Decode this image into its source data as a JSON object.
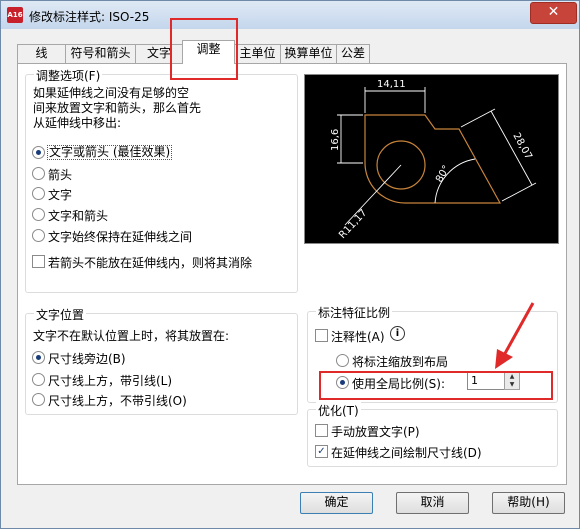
{
  "window": {
    "title": "修改标注样式: ISO-25",
    "app_icon_text": "A16",
    "close_glyph": "✕"
  },
  "tabs": [
    {
      "label": "线"
    },
    {
      "label": "符号和箭头"
    },
    {
      "label": "文字"
    },
    {
      "label": "调整"
    },
    {
      "label": "主单位"
    },
    {
      "label": "换算单位"
    },
    {
      "label": "公差"
    }
  ],
  "active_tab": "调整",
  "fit_options": {
    "title": "调整选项(F)",
    "description": [
      "如果延伸线之间没有足够的空",
      "间来放置文字和箭头，那么首先",
      "从延伸线中移出:"
    ],
    "options": [
      {
        "label": "文字或箭头 (最佳效果)",
        "selected": true
      },
      {
        "label": "箭头",
        "selected": false
      },
      {
        "label": "文字",
        "selected": false
      },
      {
        "label": "文字和箭头",
        "selected": false
      },
      {
        "label": "文字始终保持在延伸线之间",
        "selected": false
      }
    ],
    "suppress_arrows": {
      "label": "若箭头不能放在延伸线内，则将其消除",
      "checked": false
    }
  },
  "preview": {
    "dim_top": "14,11",
    "dim_left": "16,6",
    "dim_right": "28,07",
    "dim_angle": "80°",
    "dim_radius": "R11,17"
  },
  "text_placement": {
    "title": "文字位置",
    "description": "文字不在默认位置上时，将其放置在:",
    "options": [
      {
        "label": "尺寸线旁边(B)",
        "selected": true
      },
      {
        "label": "尺寸线上方，带引线(L)",
        "selected": false
      },
      {
        "label": "尺寸线上方，不带引线(O)",
        "selected": false
      }
    ]
  },
  "scale": {
    "title": "标注特征比例",
    "annotative": {
      "label": "注释性(A)",
      "checked": false
    },
    "info_glyph": "i",
    "layout_option": {
      "label": "将标注缩放到布局",
      "selected": false
    },
    "global_option": {
      "label": "使用全局比例(S):",
      "selected": true
    },
    "global_value": "1"
  },
  "fine_tuning": {
    "title": "优化(T)",
    "manual_place": {
      "label": "手动放置文字(P)",
      "checked": false
    },
    "draw_dim_line": {
      "label": "在延伸线之间绘制尺寸线(D)",
      "checked": true
    }
  },
  "buttons": {
    "ok": "确定",
    "cancel": "取消",
    "help": "帮助(H)"
  },
  "colors": {
    "annotation": "#e02a2a",
    "preview_bg": "#000000",
    "preview_geometry": "#c8843a"
  }
}
